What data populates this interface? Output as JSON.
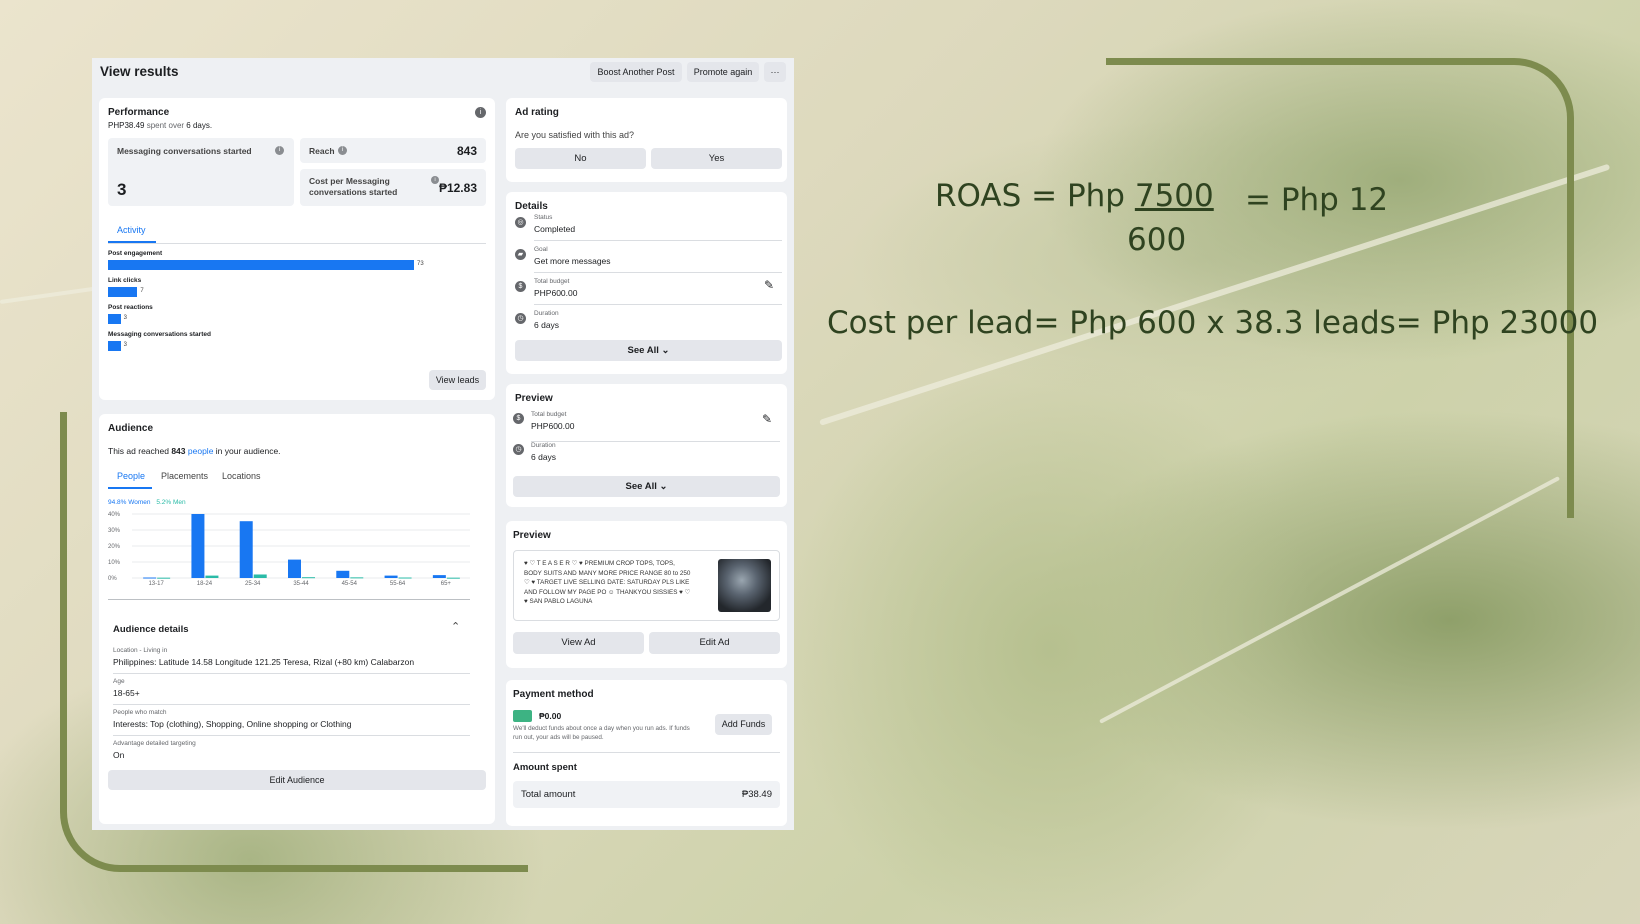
{
  "header": {
    "title": "View results",
    "boost_label": "Boost Another Post",
    "promote_label": "Promote again",
    "more_label": "···"
  },
  "performance": {
    "title": "Performance",
    "spent_amount": "PHP38.49",
    "spent_text": "spent over",
    "days": "6 days.",
    "msg_label": "Messaging conversations started",
    "msg_value": "3",
    "reach_label": "Reach",
    "reach_value": "843",
    "cpm_label_1": "Cost per Messaging",
    "cpm_label_2": "conversations started",
    "cpm_value": "₱12.83",
    "tab_activity": "Activity",
    "activity": [
      {
        "label": "Post engagement",
        "value": 73,
        "text": "73"
      },
      {
        "label": "Link clicks",
        "value": 7,
        "text": "7"
      },
      {
        "label": "Post reactions",
        "value": 3,
        "text": "3"
      },
      {
        "label": "Messaging conversations started",
        "value": 3,
        "text": "3"
      }
    ],
    "activity_max": 73,
    "view_leads_label": "View leads"
  },
  "audience": {
    "title": "Audience",
    "reach_prefix": "This ad reached",
    "reach_count": "843",
    "people_link": "people",
    "reach_suffix": "in your audience.",
    "tabs": [
      "People",
      "Placements",
      "Locations"
    ],
    "women_legend": "94.8% Women",
    "men_legend": "5.2% Men",
    "y_ticks": [
      "40%",
      "30%",
      "20%",
      "10%",
      "0%"
    ],
    "details_title": "Audience details",
    "details": [
      {
        "label": "Location - Living in",
        "value": "Philippines: Latitude 14.58 Longitude 121.25 Teresa, Rizal (+80 km) Calabarzon"
      },
      {
        "label": "Age",
        "value": "18-65+"
      },
      {
        "label": "People who match",
        "value": "Interests: Top (clothing), Shopping, Online shopping or Clothing"
      },
      {
        "label": "Advantage detailed targeting",
        "value": "On"
      }
    ],
    "edit_label": "Edit Audience"
  },
  "chart_data": {
    "type": "bar",
    "categories": [
      "13-17",
      "18-24",
      "25-34",
      "35-44",
      "45-54",
      "55-64",
      "65+"
    ],
    "series": [
      {
        "name": "94.8% Women",
        "values": [
          0.3,
          40,
          35.5,
          11.5,
          4.5,
          1.5,
          1.8
        ]
      },
      {
        "name": "5.2% Men",
        "values": [
          0.2,
          1.5,
          2.2,
          0.5,
          0.4,
          0.3,
          0.2
        ]
      }
    ],
    "ylim": [
      0,
      40
    ]
  },
  "ad_rating": {
    "title": "Ad rating",
    "question": "Are you satisfied with this ad?",
    "no_label": "No",
    "yes_label": "Yes"
  },
  "details": {
    "title": "Details",
    "rows": [
      {
        "label": "Status",
        "value": "Completed",
        "icon": "status-icon"
      },
      {
        "label": "Goal",
        "value": "Get more messages",
        "icon": "chat-icon"
      },
      {
        "label": "Total budget",
        "value": "PHP600.00",
        "icon": "money-icon"
      },
      {
        "label": "Duration",
        "value": "6 days",
        "icon": "clock-icon"
      }
    ],
    "see_all_label": "See All ⌄"
  },
  "preview_budget": {
    "title": "Preview",
    "rows": [
      {
        "label": "Total budget",
        "value": "PHP600.00"
      },
      {
        "label": "Duration",
        "value": "6 days"
      }
    ],
    "see_all_label": "See All ⌄"
  },
  "preview_ad": {
    "title": "Preview",
    "text_lines": [
      "♥ ♡ T E A S E R ♡ ♥ PREMIUM CROP TOPS, TOPS,",
      "BODY SUITS AND MANY MORE PRICE RANGE 80 to 250",
      "♡ ♥ TARGET LIVE SELLING DATE: SATURDAY PLS LIKE",
      "AND FOLLOW MY PAGE PO ☺ THANKYOU SISSIES ♥ ♡",
      "♥ SAN PABLO LAGUNA"
    ],
    "view_label": "View Ad",
    "edit_label": "Edit Ad"
  },
  "payment": {
    "title": "Payment method",
    "balance": "₱0.00",
    "note_1": "We'll deduct funds about once a day when you run ads. If funds",
    "note_2": "run out, your ads will be paused.",
    "add_funds_label": "Add Funds",
    "amount_title": "Amount spent",
    "total_label": "Total amount",
    "total_value": "₱38.49"
  },
  "formulas": {
    "roas_prefix": "ROAS = Php",
    "roas_num": "7500",
    "roas_den": "600",
    "roas_result": "= Php 12",
    "cpl": "Cost per lead= Php 600 x 38.3 leads= Php 23000"
  },
  "colors": {
    "frame": "#7d8b4e",
    "accent": "#1877f2",
    "men": "#2abba7",
    "formula_text": "#2f4320"
  }
}
